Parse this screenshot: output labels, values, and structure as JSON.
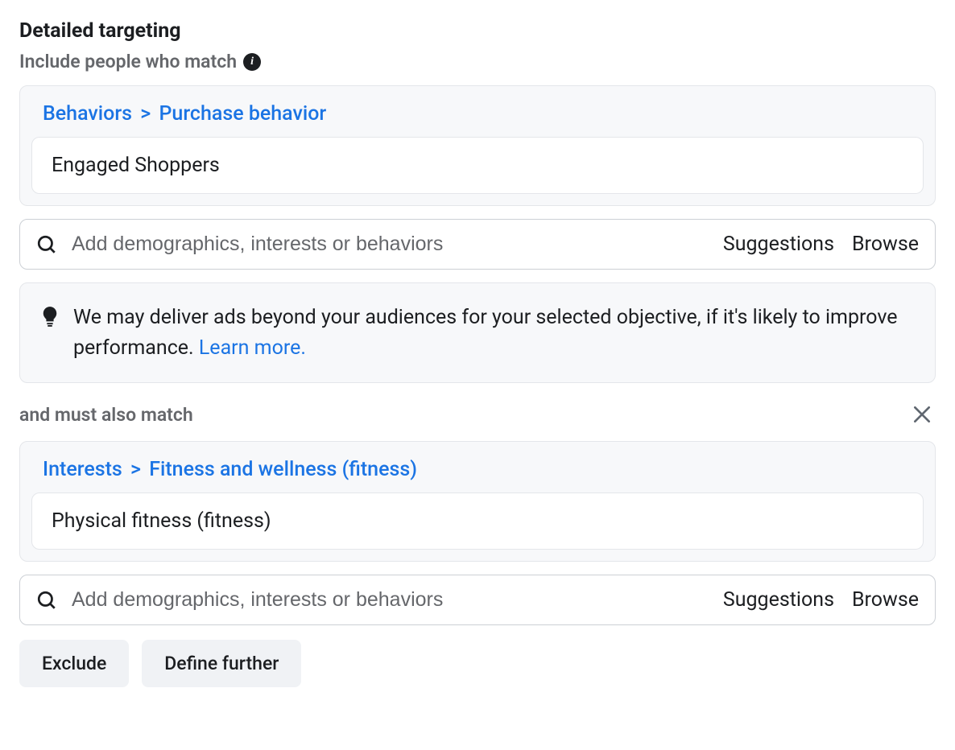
{
  "header": {
    "title": "Detailed targeting",
    "include_label": "Include people who match"
  },
  "group1": {
    "breadcrumb": {
      "part1": "Behaviors",
      "sep": ">",
      "part2": "Purchase behavior"
    },
    "token": "Engaged Shoppers",
    "search": {
      "placeholder": "Add demographics, interests or behaviors",
      "suggestions_label": "Suggestions",
      "browse_label": "Browse"
    }
  },
  "info": {
    "text": "We may deliver ads beyond your audiences for your selected objective, if it's likely to improve performance. ",
    "link": "Learn more."
  },
  "mid": {
    "label": "and must also match"
  },
  "group2": {
    "breadcrumb": {
      "part1": "Interests",
      "sep": ">",
      "part2": "Fitness and wellness (fitness)"
    },
    "token": "Physical fitness (fitness)",
    "search": {
      "placeholder": "Add demographics, interests or behaviors",
      "suggestions_label": "Suggestions",
      "browse_label": "Browse"
    }
  },
  "buttons": {
    "exclude": "Exclude",
    "define_further": "Define further"
  }
}
